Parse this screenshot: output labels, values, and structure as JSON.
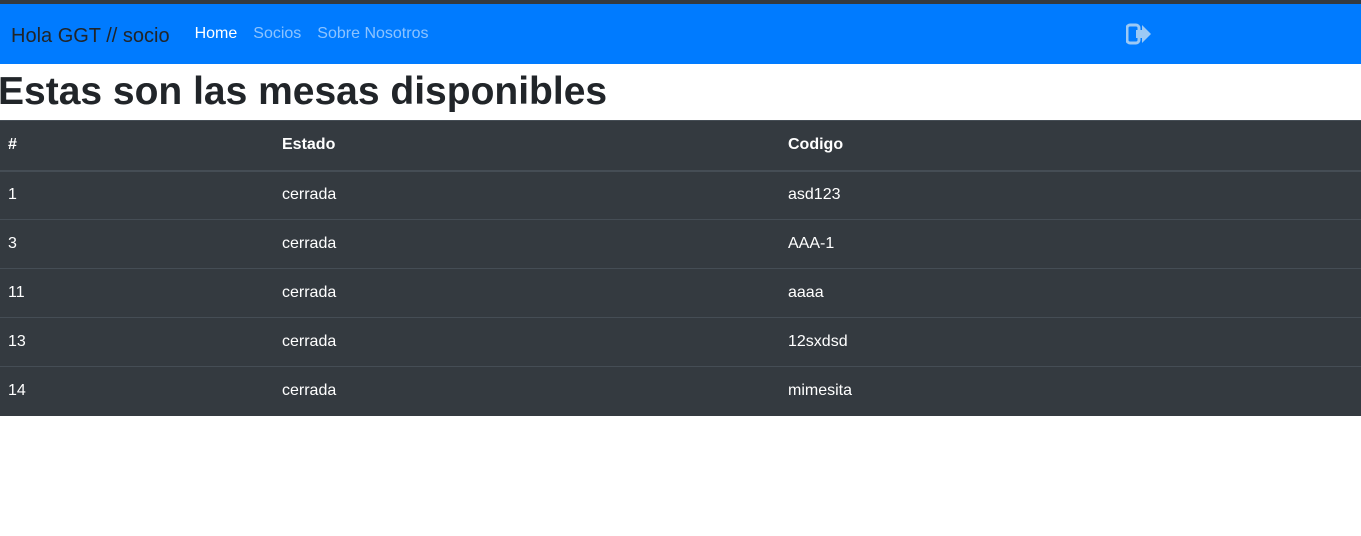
{
  "navbar": {
    "brand": "Hola GGT // socio",
    "links": [
      {
        "label": "Home",
        "active": true
      },
      {
        "label": "Socios",
        "active": false
      },
      {
        "label": "Sobre Nosotros",
        "active": false
      }
    ],
    "logout_icon": "sign-out-icon",
    "accent_color": "#007bff"
  },
  "main": {
    "title": "Estas son las mesas disponibles",
    "table": {
      "headers": [
        "#",
        "Estado",
        "Codigo"
      ],
      "rows": [
        {
          "id": "1",
          "estado": "cerrada",
          "codigo": "asd123"
        },
        {
          "id": "3",
          "estado": "cerrada",
          "codigo": "AAA-1"
        },
        {
          "id": "11",
          "estado": "cerrada",
          "codigo": "aaaa"
        },
        {
          "id": "13",
          "estado": "cerrada",
          "codigo": "12sxdsd"
        },
        {
          "id": "14",
          "estado": "cerrada",
          "codigo": "mimesita"
        }
      ]
    }
  }
}
